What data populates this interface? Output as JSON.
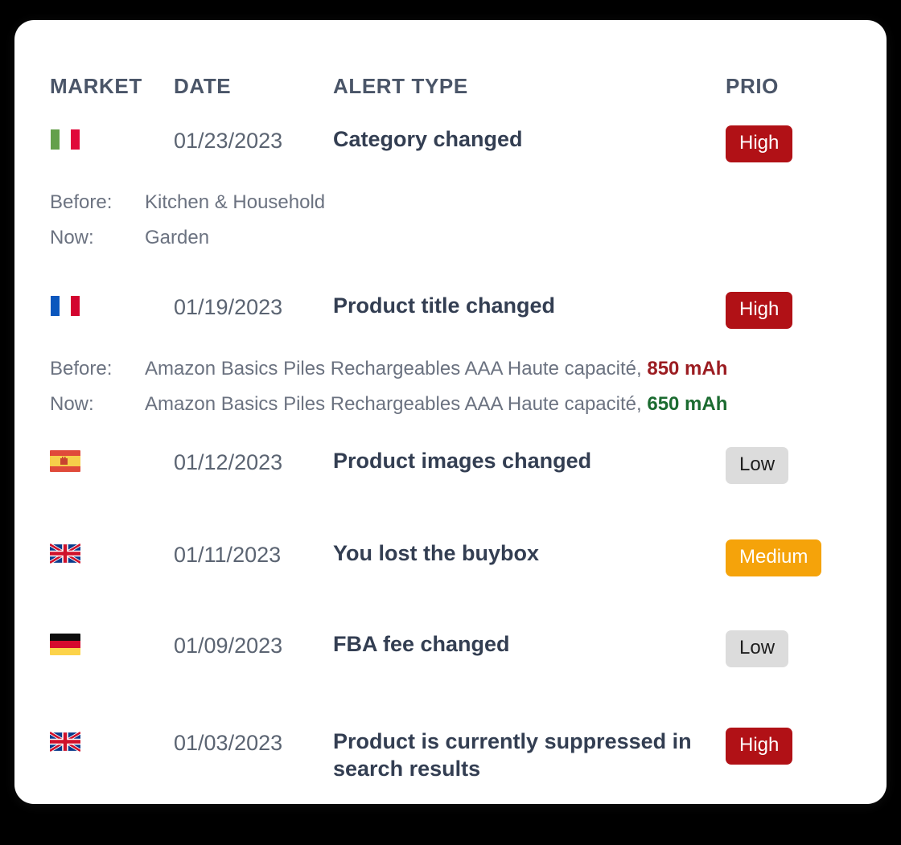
{
  "card": {
    "background": "#ffffff",
    "accent_high": "#b11116",
    "accent_medium": "#f5a30a",
    "accent_low": "#dcdcdc"
  },
  "table": {
    "headers": {
      "market": "MARKET",
      "date": "DATE",
      "alert_type": "ALERT TYPE",
      "prio": "PRIO"
    },
    "rows": [
      {
        "flag": "flag-italy-icon",
        "market": "Italy",
        "date": "01/23/2023",
        "alert_type": "Category changed",
        "prio": "High",
        "prio_level": "high",
        "details": [
          {
            "label": "Before:",
            "value": "Kitchen & Household"
          },
          {
            "label": "Now:",
            "value": "Garden"
          }
        ]
      },
      {
        "flag": "flag-france-icon",
        "market": "France",
        "date": "01/19/2023",
        "alert_type": "Product title changed",
        "prio": "High",
        "prio_level": "high",
        "details": [
          {
            "label": "Before:",
            "value_prefix": "Amazon Basics Piles Rechargeables AAA Haute capacité, ",
            "value_highlight": "850 mAh",
            "highlight_color": "#9b1c21"
          },
          {
            "label": "Now:",
            "value_prefix": "Amazon Basics Piles Rechargeables AAA Haute capacité, ",
            "value_highlight": "650 mAh",
            "highlight_color": "#1b6b30"
          }
        ]
      },
      {
        "flag": "flag-spain-icon",
        "market": "Spain",
        "date": "01/12/2023",
        "alert_type": "Product images changed",
        "prio": "Low",
        "prio_level": "low",
        "details": []
      },
      {
        "flag": "flag-uk-icon",
        "market": "United Kingdom",
        "date": "01/11/2023",
        "alert_type": "You lost the buybox",
        "prio": "Medium",
        "prio_level": "medium",
        "details": []
      },
      {
        "flag": "flag-germany-icon",
        "market": "Germany",
        "date": "01/09/2023",
        "alert_type": "FBA fee changed",
        "prio": "Low",
        "prio_level": "low",
        "details": []
      },
      {
        "flag": "flag-uk-icon",
        "market": "United Kingdom",
        "date": "01/03/2023",
        "alert_type": "Product is currently suppressed in search results",
        "prio": "High",
        "prio_level": "high",
        "details": []
      }
    ]
  }
}
